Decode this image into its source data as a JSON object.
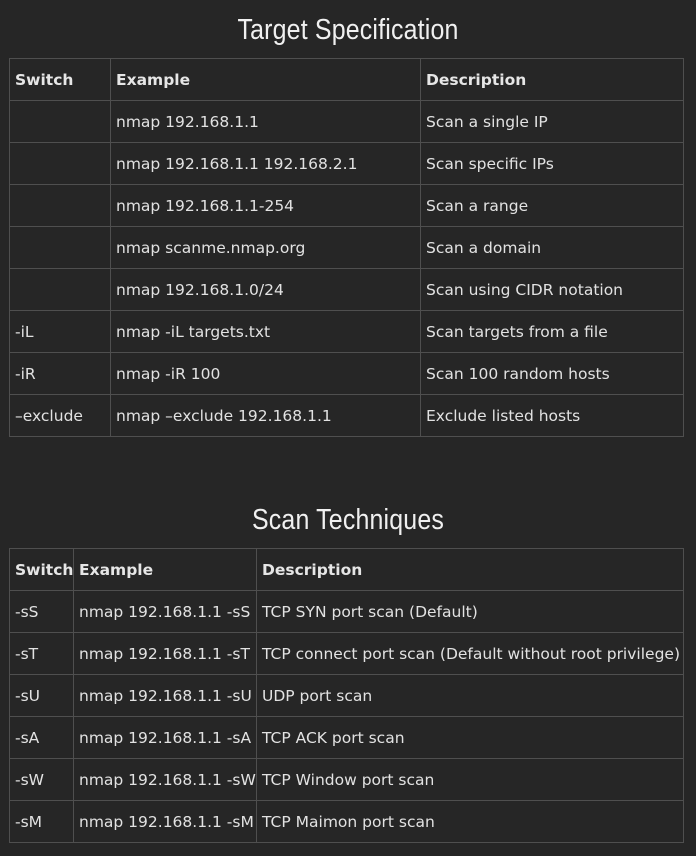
{
  "sections": [
    {
      "title": "Target Specification",
      "headers": [
        "Switch",
        "Example",
        "Description"
      ],
      "rows": [
        [
          "",
          "nmap 192.168.1.1",
          "Scan a single IP"
        ],
        [
          "",
          "nmap 192.168.1.1 192.168.2.1",
          "Scan specific IPs"
        ],
        [
          "",
          "nmap 192.168.1.1-254",
          "Scan a range"
        ],
        [
          "",
          "nmap scanme.nmap.org",
          "Scan a domain"
        ],
        [
          "",
          "nmap 192.168.1.0/24",
          "Scan using CIDR notation"
        ],
        [
          "-iL",
          "nmap -iL targets.txt",
          "Scan targets from a file"
        ],
        [
          "-iR",
          "nmap -iR 100",
          "Scan 100 random hosts"
        ],
        [
          "–exclude",
          "nmap –exclude 192.168.1.1",
          "Exclude listed hosts"
        ]
      ]
    },
    {
      "title": "Scan Techniques",
      "headers": [
        "Switch",
        "Example",
        "Description"
      ],
      "rows": [
        [
          "-sS",
          "nmap 192.168.1.1 -sS",
          "TCP SYN port scan (Default)"
        ],
        [
          "-sT",
          "nmap 192.168.1.1 -sT",
          "TCP connect port scan (Default without root privilege)"
        ],
        [
          "-sU",
          "nmap 192.168.1.1 -sU",
          "UDP port scan"
        ],
        [
          "-sA",
          "nmap 192.168.1.1 -sA",
          "TCP ACK port scan"
        ],
        [
          "-sW",
          "nmap 192.168.1.1 -sW",
          "TCP Window port scan"
        ],
        [
          "-sM",
          "nmap 192.168.1.1 -sM",
          "TCP Maimon port scan"
        ]
      ]
    }
  ],
  "colors": {
    "background": "#262626",
    "border": "#4f4f4f",
    "text": "#e2e2e2"
  }
}
